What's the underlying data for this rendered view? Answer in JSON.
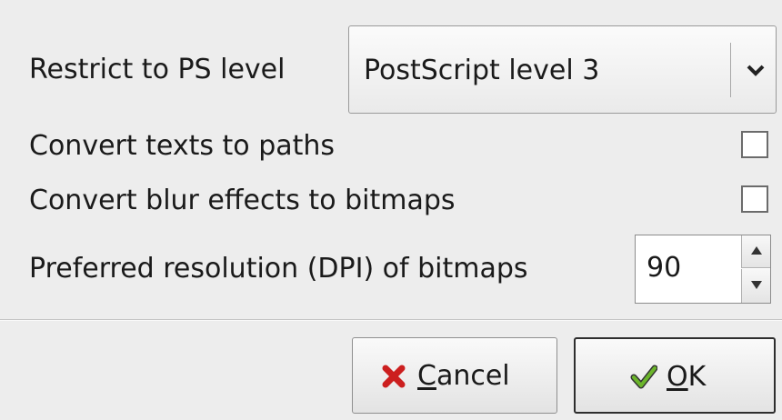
{
  "ps_level": {
    "label": "Restrict to PS level",
    "selected": "PostScript level 3"
  },
  "options": {
    "texts_to_paths": {
      "label": "Convert texts to paths",
      "checked": false
    },
    "blur_to_bitmaps": {
      "label": "Convert blur effects to bitmaps",
      "checked": false
    }
  },
  "resolution": {
    "label": "Preferred resolution (DPI) of bitmaps",
    "value": "90"
  },
  "buttons": {
    "cancel": {
      "mnemonic": "C",
      "rest": "ancel",
      "icon": "cancel-x-icon"
    },
    "ok": {
      "mnemonic": "O",
      "rest": "K",
      "icon": "checkmark-icon"
    }
  },
  "colors": {
    "cancel_icon": "#cc1f1f",
    "ok_icon": "#6bb52b"
  }
}
